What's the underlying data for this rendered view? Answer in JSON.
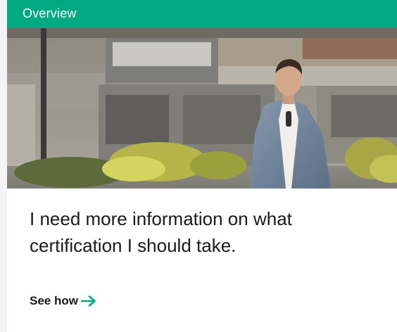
{
  "banner": {
    "label": "Overview",
    "color": "#01a982"
  },
  "hero": {
    "image": "photo-man-in-suit-outdoors"
  },
  "card": {
    "title": "I need more information on what certification I should take.",
    "link_label": "See how",
    "link_icon": "arrow-right-icon",
    "accent_color": "#01a982"
  }
}
